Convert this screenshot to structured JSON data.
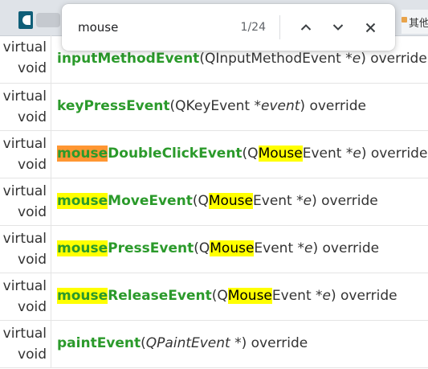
{
  "browser": {
    "right_tab_label": "其他"
  },
  "find": {
    "query": "mouse",
    "count": "1/24",
    "prev_icon": "chevron-up-icon",
    "next_icon": "chevron-down-icon",
    "close_icon": "close-icon"
  },
  "rows": [
    {
      "ret1": "virtual",
      "ret2": "void",
      "name_hl": "",
      "name_rest": "inputMethodEvent",
      "open": "(",
      "ptype_hl": "",
      "ptype_rest": "QInputMethodEvent *",
      "param": "e",
      "close": ") override"
    },
    {
      "ret1": "virtual",
      "ret2": "void",
      "name_hl": "",
      "name_rest": "keyPressEvent",
      "open": "(",
      "ptype_hl": "",
      "ptype_rest": "QKeyEvent *",
      "param": "event",
      "close": ") override"
    },
    {
      "ret1": "virtual",
      "ret2": "void",
      "name_hl": "mouse",
      "name_rest": "DoubleClickEvent",
      "open": "(Q",
      "ptype_hl": "Mouse",
      "ptype_rest": "Event *",
      "param": "e",
      "close": ") override"
    },
    {
      "ret1": "virtual",
      "ret2": "void",
      "name_hl": "mouse",
      "name_rest": "MoveEvent",
      "open": "(Q",
      "ptype_hl": "Mouse",
      "ptype_rest": "Event *",
      "param": "e",
      "close": ") override"
    },
    {
      "ret1": "virtual",
      "ret2": "void",
      "name_hl": "mouse",
      "name_rest": "PressEvent",
      "open": "(Q",
      "ptype_hl": "Mouse",
      "ptype_rest": "Event *",
      "param": "e",
      "close": ") override"
    },
    {
      "ret1": "virtual",
      "ret2": "void",
      "name_hl": "mouse",
      "name_rest": "ReleaseEvent",
      "open": "(Q",
      "ptype_hl": "Mouse",
      "ptype_rest": "Event *",
      "param": "e",
      "close": ") override"
    },
    {
      "ret1": "virtual",
      "ret2": "void",
      "name_hl": "",
      "name_rest": "paintEvent",
      "open": "(",
      "ptype_hl": "",
      "ptype_rest": "QPaintEvent",
      "param": "",
      "close": " *) override"
    }
  ],
  "colors": {
    "function_name": "#2b9a2b",
    "highlight": "#ffff00",
    "current_highlight": "#ff9632"
  }
}
